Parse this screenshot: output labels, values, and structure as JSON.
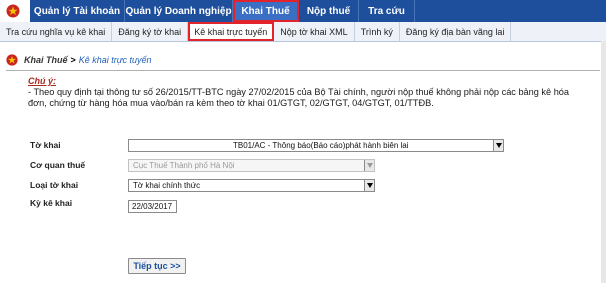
{
  "nav": {
    "items": [
      {
        "label": "Quản lý Tài khoản",
        "active": false
      },
      {
        "label": "Quản lý Doanh nghiệp",
        "active": false
      },
      {
        "label": "Khai Thuế",
        "active": true
      },
      {
        "label": "Nộp thuế",
        "active": false
      },
      {
        "label": "Tra cứu",
        "active": false
      }
    ]
  },
  "subnav": {
    "items": [
      {
        "label": "Tra cứu nghĩa vụ kê khai",
        "active": false
      },
      {
        "label": "Đăng ký tờ khai",
        "active": false
      },
      {
        "label": "Kê khai trực tuyến",
        "active": true
      },
      {
        "label": "Nộp tờ khai XML",
        "active": false
      },
      {
        "label": "Trình ký",
        "active": false
      },
      {
        "label": "Đăng ký địa bàn vãng lai",
        "active": false
      }
    ]
  },
  "breadcrumb": {
    "section": "Khai Thuế",
    "separator": ">",
    "page": "Kê khai trực tuyến"
  },
  "note": {
    "title": "Chú ý:",
    "text": "- Theo quy định tại thông tư số 26/2015/TT-BTC ngày 27/02/2015 của Bộ Tài chính, người nộp thuế không phải nộp các bảng kê hóa đơn, chứng từ hàng hóa mua vào/bán ra kèm theo tờ khai 01/GTGT, 02/GTGT, 04/GTGT, 01/TTĐB."
  },
  "form": {
    "to_khai": {
      "label": "Tờ khai",
      "value": "TB01/AC - Thông báo(Báo cáo)phát hành biên lai"
    },
    "co_quan_thue": {
      "label": "Cơ quan thuế",
      "value": "Cục Thuế Thành phố Hà Nội"
    },
    "loai_to_khai": {
      "label": "Loại tờ khai",
      "value": "Tờ khai chính thức"
    },
    "ky_ke_khai": {
      "label": "Kỳ kê khai",
      "value": "22/03/2017"
    }
  },
  "actions": {
    "continue_label": "Tiếp tục >>"
  },
  "colors": {
    "nav_bg": "#1d4f9c",
    "highlight": "#e3232b",
    "link": "#2060b8",
    "note_title": "#a8271d"
  }
}
